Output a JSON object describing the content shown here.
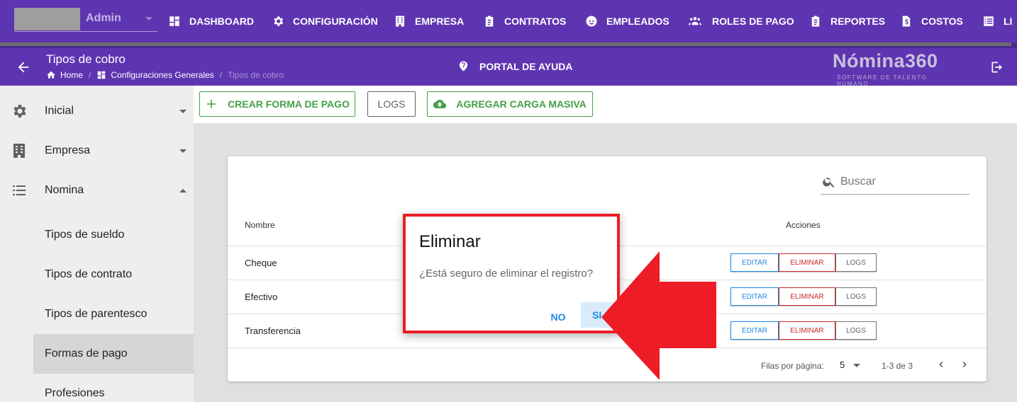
{
  "topnav": {
    "admin_label": "Admin",
    "items": [
      {
        "label": "DASHBOARD",
        "icon": "dashboard-icon"
      },
      {
        "label": "CONFIGURACIÓN",
        "icon": "gear-icon"
      },
      {
        "label": "EMPRESA",
        "icon": "building-icon"
      },
      {
        "label": "CONTRATOS",
        "icon": "clipboard-icon"
      },
      {
        "label": "EMPLEADOS",
        "icon": "face-icon"
      },
      {
        "label": "ROLES DE PAGO",
        "icon": "users-icon"
      },
      {
        "label": "REPORTES",
        "icon": "clipboard-icon"
      },
      {
        "label": "COSTOS",
        "icon": "file-dollar-icon"
      },
      {
        "label": "LI",
        "icon": "list-icon"
      }
    ]
  },
  "subheader": {
    "title": "Tipos de cobro",
    "breadcrumb": {
      "home": "Home",
      "section": "Configuraciones Generales",
      "current": "Tipos de cobro"
    },
    "help_portal": "PORTAL DE AYUDA",
    "brand_name": "Nómina360",
    "brand_tagline": "SOFTWARE DE TALENTO HUMANO"
  },
  "sidebar": {
    "groups": [
      {
        "label": "Inicial",
        "icon": "gear-icon",
        "expanded": false
      },
      {
        "label": "Empresa",
        "icon": "building-icon",
        "expanded": false
      },
      {
        "label": "Nomina",
        "icon": "list-icon",
        "expanded": true
      }
    ],
    "subitems": [
      {
        "label": "Tipos de sueldo",
        "active": false
      },
      {
        "label": "Tipos de contrato",
        "active": false
      },
      {
        "label": "Tipos de parentesco",
        "active": false
      },
      {
        "label": "Formas de pago",
        "active": true
      },
      {
        "label": "Profesiones",
        "active": false
      }
    ]
  },
  "toolbar": {
    "create_label": "CREAR FORMA DE PAGO",
    "logs_label": "LOGS",
    "bulk_label": "AGREGAR CARGA MASIVA"
  },
  "table": {
    "search_placeholder": "Buscar",
    "columns": [
      "Nombre",
      "Acciones"
    ],
    "rows": [
      {
        "name": "Cheque"
      },
      {
        "name": "Efectivo"
      },
      {
        "name": "Transferencia"
      }
    ],
    "actions": {
      "edit": "EDITAR",
      "delete": "ELIMINAR",
      "logs": "LOGS"
    },
    "footer": {
      "rows_per_page_label": "Filas por página:",
      "rows_per_page": "5",
      "range": "1-3 de 3"
    }
  },
  "dialog": {
    "title": "Eliminar",
    "message": "¿Está seguro de eliminar el registro?",
    "no_label": "NO",
    "yes_label": "SI"
  },
  "colors": {
    "nav_purple": "#5e35b1",
    "highlight_red": "#ee1c25",
    "primary_blue": "#1e88e5",
    "success_green": "#43a047",
    "danger_red": "#c62828"
  }
}
